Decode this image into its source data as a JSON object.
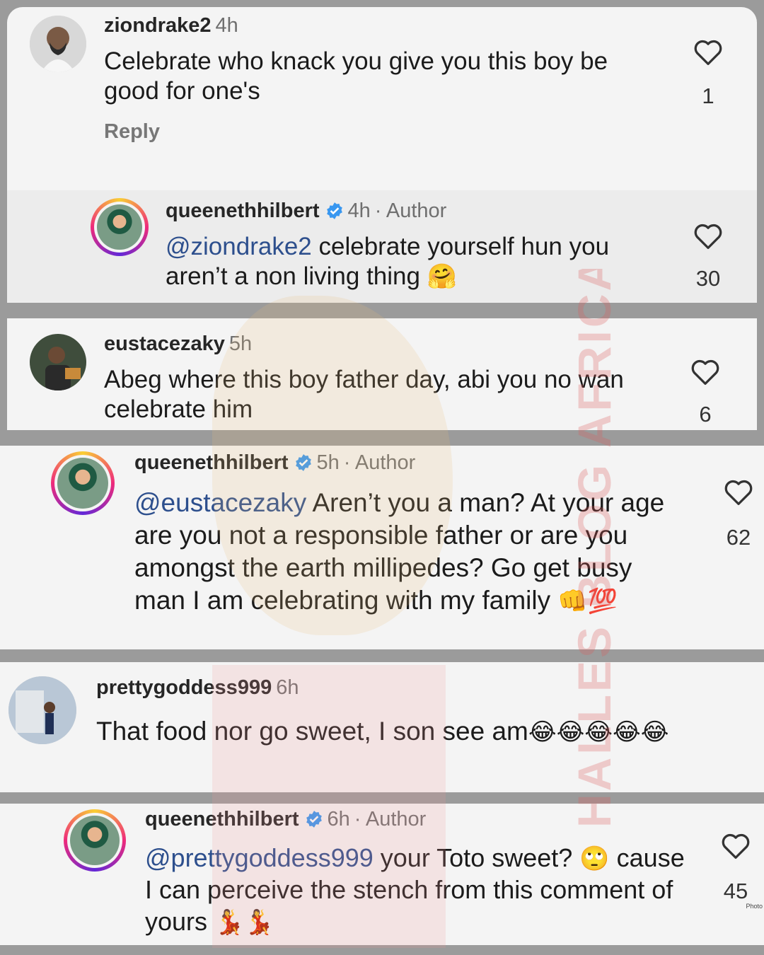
{
  "comments": [
    {
      "username": "ziondrake2",
      "time": "4h",
      "text": "Celebrate who knack you give you this boy be good for one's",
      "reply_label": "Reply",
      "likes": "1"
    },
    {
      "username": "queenethhilbert",
      "time": "4h",
      "author": "· Author",
      "mention": "@ziondrake2",
      "text": "celebrate yourself hun you aren’t a non living thing",
      "emoji": "🤗",
      "likes": "30"
    },
    {
      "username": "eustacezaky",
      "time": "5h",
      "text": "Abeg where this boy father day, abi you no wan celebrate him",
      "likes": "6"
    },
    {
      "username": "queenethhilbert",
      "time": "5h",
      "author": "· Author",
      "mention": "@eustacezaky",
      "text": "Aren’t you a man? At your age are you not a responsible father or are you amongst the earth millipedes? Go get busy man I am celebrating with my family",
      "emoji": "👊💯",
      "likes": "62"
    },
    {
      "username": "prettygoddess999",
      "time": "6h",
      "text": "That food nor go sweet, I son see am",
      "emoji": "😂😂😂😂😂"
    },
    {
      "username": "queenethhilbert",
      "time": "6h",
      "author": "· Author",
      "mention": "@prettygoddess999",
      "text": "your Toto sweet?",
      "emoji1": "🙄",
      "text2": "cause I can perceive the stench from this comment of yours",
      "emoji2": "💃💃",
      "likes": "45"
    }
  ],
  "watermark": "HALLES BLOG AFRICA",
  "photo_credit": "Photo",
  "colors": {
    "mention": "#2d4f8d",
    "verified": "#3897f0",
    "panel": "#f4f4f4",
    "background": "#9b9b9b"
  },
  "icons": [
    "heart-icon",
    "verified-badge-icon"
  ]
}
